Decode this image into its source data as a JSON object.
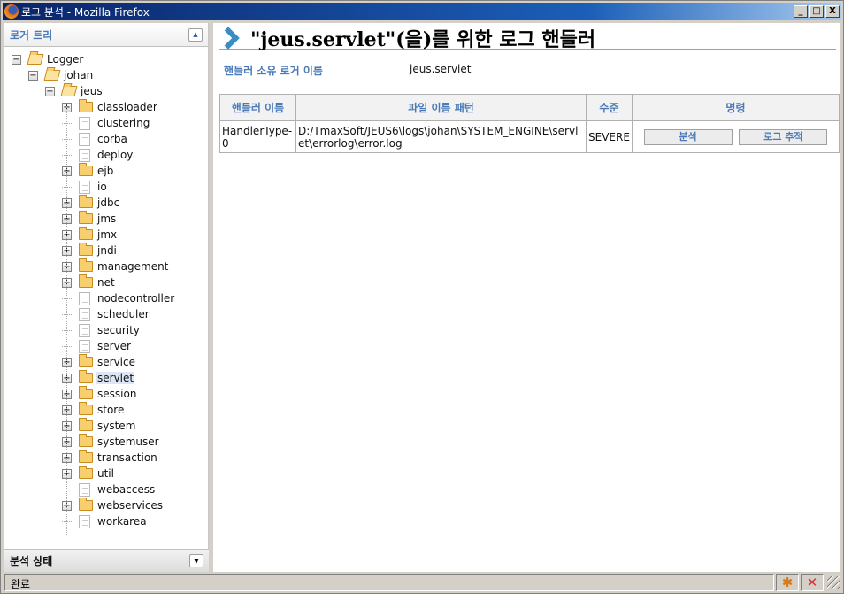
{
  "window": {
    "title": "로그 분석 - Mozilla Firefox",
    "controls": {
      "minimize": "_",
      "maximize": "□",
      "close": "X"
    }
  },
  "sidebar": {
    "panel_title": "로거 트리",
    "collapse_icon": "▲",
    "tree": [
      {
        "label": "Logger",
        "depth": 0,
        "type": "folder-open",
        "expander": "−"
      },
      {
        "label": "johan",
        "depth": 1,
        "type": "folder-open",
        "expander": "−"
      },
      {
        "label": "jeus",
        "depth": 2,
        "type": "folder-open",
        "expander": "−"
      },
      {
        "label": "classloader",
        "depth": 3,
        "type": "folder",
        "expander": "+"
      },
      {
        "label": "clustering",
        "depth": 3,
        "type": "doc",
        "expander": ""
      },
      {
        "label": "corba",
        "depth": 3,
        "type": "doc",
        "expander": ""
      },
      {
        "label": "deploy",
        "depth": 3,
        "type": "doc",
        "expander": ""
      },
      {
        "label": "ejb",
        "depth": 3,
        "type": "folder",
        "expander": "+"
      },
      {
        "label": "io",
        "depth": 3,
        "type": "doc",
        "expander": ""
      },
      {
        "label": "jdbc",
        "depth": 3,
        "type": "folder",
        "expander": "+"
      },
      {
        "label": "jms",
        "depth": 3,
        "type": "folder",
        "expander": "+"
      },
      {
        "label": "jmx",
        "depth": 3,
        "type": "folder",
        "expander": "+"
      },
      {
        "label": "jndi",
        "depth": 3,
        "type": "folder",
        "expander": "+"
      },
      {
        "label": "management",
        "depth": 3,
        "type": "folder",
        "expander": "+"
      },
      {
        "label": "net",
        "depth": 3,
        "type": "folder",
        "expander": "+"
      },
      {
        "label": "nodecontroller",
        "depth": 3,
        "type": "doc",
        "expander": ""
      },
      {
        "label": "scheduler",
        "depth": 3,
        "type": "doc",
        "expander": ""
      },
      {
        "label": "security",
        "depth": 3,
        "type": "doc",
        "expander": ""
      },
      {
        "label": "server",
        "depth": 3,
        "type": "doc",
        "expander": ""
      },
      {
        "label": "service",
        "depth": 3,
        "type": "folder",
        "expander": "+"
      },
      {
        "label": "servlet",
        "depth": 3,
        "type": "folder",
        "expander": "+",
        "selected": true
      },
      {
        "label": "session",
        "depth": 3,
        "type": "folder",
        "expander": "+"
      },
      {
        "label": "store",
        "depth": 3,
        "type": "folder",
        "expander": "+"
      },
      {
        "label": "system",
        "depth": 3,
        "type": "folder",
        "expander": "+"
      },
      {
        "label": "systemuser",
        "depth": 3,
        "type": "folder",
        "expander": "+"
      },
      {
        "label": "transaction",
        "depth": 3,
        "type": "folder",
        "expander": "+"
      },
      {
        "label": "util",
        "depth": 3,
        "type": "folder",
        "expander": "+"
      },
      {
        "label": "webaccess",
        "depth": 3,
        "type": "doc",
        "expander": ""
      },
      {
        "label": "webservices",
        "depth": 3,
        "type": "folder",
        "expander": "+"
      },
      {
        "label": "workarea",
        "depth": 3,
        "type": "doc",
        "expander": ""
      }
    ],
    "bottom_panel_title": "분석 상태",
    "expand_icon": "▼"
  },
  "main": {
    "title": "\"jeus.servlet\"(을)를 위한 로그 핸들러",
    "owner_label": "핸들러 소유 로거 이름",
    "owner_value": "jeus.servlet",
    "table": {
      "headers": [
        "핸들러 이름",
        "파일 이름 패턴",
        "수준",
        "명령"
      ],
      "rows": [
        {
          "name": "HandlerType-0",
          "pattern": "D:/TmaxSoft/JEUS6\\logs\\johan\\SYSTEM_ENGINE\\servlet\\errorlog\\error.log",
          "level": "SEVERE",
          "actions": [
            "분석",
            "로그 추적"
          ]
        }
      ]
    }
  },
  "statusbar": {
    "text": "완료",
    "icons": [
      "bug-icon",
      "stop-icon"
    ]
  },
  "colors": {
    "accent": "#4a7ab8",
    "title_bar": "#0a246a",
    "chevron": "#3a8dc4",
    "selected_bg": "#dde6f6"
  }
}
